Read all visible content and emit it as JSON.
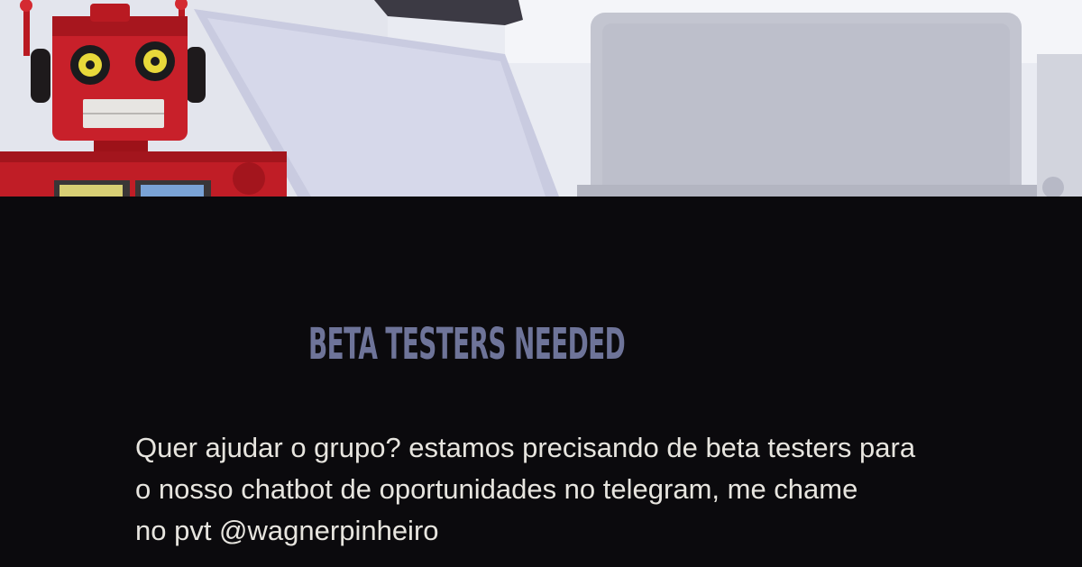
{
  "banner": {
    "image": "robot-toy-and-laptop-photo"
  },
  "headline": "BETA TESTERS NEEDED",
  "message": {
    "lines": [
      "Quer ajudar o grupo? estamos precisando de beta testers para",
      "o nosso chatbot de oportunidades no telegram, me chame",
      "no pvt @wagnerpinheiro"
    ]
  },
  "colors": {
    "background": "#0b0a0d",
    "headline": "#6e7499",
    "body_text": "#e7e5df",
    "robot_red": "#c8202a"
  }
}
